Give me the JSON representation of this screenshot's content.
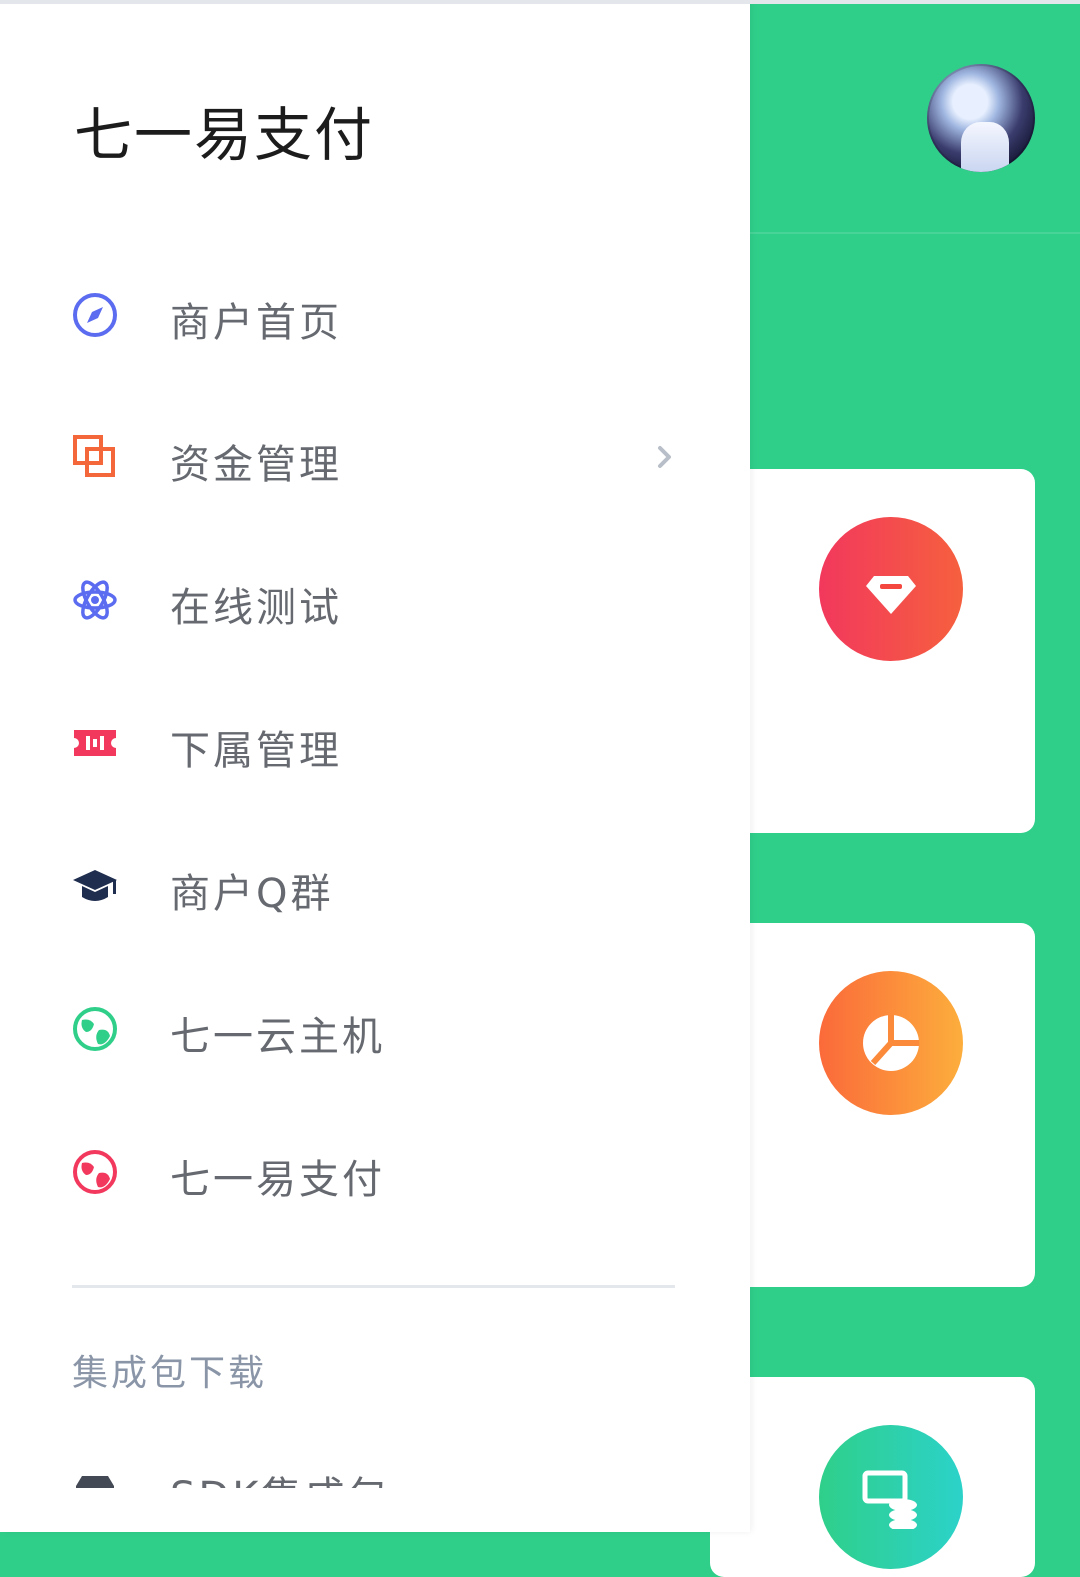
{
  "drawer": {
    "brand_title": "七一易支付",
    "menu": [
      {
        "label": "商户首页",
        "icon": "compass-icon",
        "color": "#5b6cf0"
      },
      {
        "label": "资金管理",
        "icon": "copy-squares-icon",
        "color": "#f4673a",
        "has_submenu": true
      },
      {
        "label": "在线测试",
        "icon": "atom-icon",
        "color": "#5b6cf0"
      },
      {
        "label": "下属管理",
        "icon": "ticket-icon",
        "color": "#f2385d"
      },
      {
        "label": "商户Q群",
        "icon": "graduation-cap-icon",
        "color": "#1f2d4e"
      },
      {
        "label": "七一云主机",
        "icon": "globe-icon",
        "color": "#2fcf8a"
      },
      {
        "label": "七一易支付",
        "icon": "globe-icon",
        "color": "#f2385d"
      }
    ],
    "section_title": "集成包下载",
    "sdk_item": {
      "label": "SDK集成包",
      "icon": "archive-icon"
    }
  },
  "background_app": {
    "accent_color": "#2fcf8a",
    "cards": [
      {
        "icon": "diamond-icon"
      },
      {
        "icon": "pie-chart-icon"
      },
      {
        "icon": "coins-icon"
      }
    ]
  }
}
